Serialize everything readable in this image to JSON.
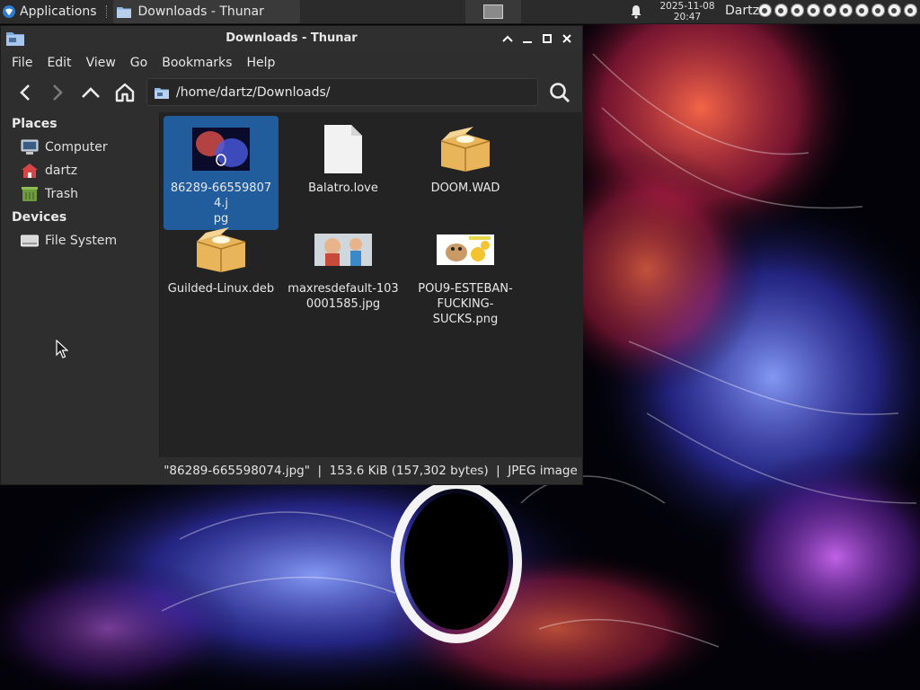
{
  "panel": {
    "applications_label": "Applications",
    "task_label": "Downloads - Thunar",
    "clock_date": "2025-11-08",
    "clock_time": "20:47",
    "username": "Dartz",
    "tray_count": 10
  },
  "window": {
    "title": "Downloads - Thunar",
    "controls": {
      "minimize": "minimize",
      "maximize": "maximize",
      "close": "close"
    }
  },
  "menubar": {
    "items": [
      "File",
      "Edit",
      "View",
      "Go",
      "Bookmarks",
      "Help"
    ]
  },
  "toolbar": {
    "location": "/home/dartz/Downloads/"
  },
  "sidebar": {
    "places_header": "Places",
    "places": [
      {
        "label": "Computer",
        "icon": "computer-icon"
      },
      {
        "label": "dartz",
        "icon": "home-folder-icon"
      },
      {
        "label": "Trash",
        "icon": "trash-icon"
      }
    ],
    "devices_header": "Devices",
    "devices": [
      {
        "label": "File System",
        "icon": "drive-icon"
      }
    ]
  },
  "files": [
    {
      "name": "86289-665598074.jpg",
      "display": "86289-665598074.j\npg",
      "type": "image",
      "selected": true
    },
    {
      "name": "Balatro.love",
      "display": "Balatro.love",
      "type": "generic"
    },
    {
      "name": "DOOM.WAD",
      "display": "DOOM.WAD",
      "type": "package"
    },
    {
      "name": "Guilded-Linux.deb",
      "display": "Guilded-Linux.deb",
      "type": "package"
    },
    {
      "name": "maxresdefault-1030001585.jpg",
      "display": "maxresdefault-103\n0001585.jpg",
      "type": "image"
    },
    {
      "name": "POU9-ESTEBAN-FUCKING-SUCKS.png",
      "display": "POU9-ESTEBAN-\nFUCKING-\nSUCKS.png",
      "type": "image"
    }
  ],
  "statusbar": {
    "text": "\"86289-665598074.jpg\"  |  153.6 KiB (157,302 bytes)  |  JPEG image"
  },
  "colors": {
    "panel_bg": "#2b2b2b",
    "window_bg": "#2e2e2e",
    "view_bg": "#232323",
    "selection": "#215d9c"
  }
}
